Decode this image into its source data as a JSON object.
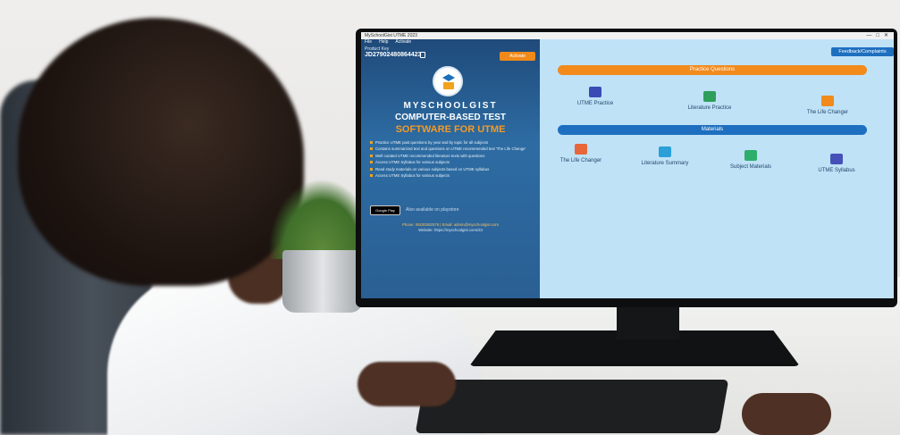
{
  "app": {
    "window_title": "MySchoolGist UTME 2023",
    "menu": [
      "File",
      "Help",
      "Activate"
    ],
    "window_controls": [
      "—",
      "□",
      "✕"
    ]
  },
  "left_panel": {
    "product_key_label": "Product Key",
    "product_key": "JD27902480864423",
    "activate_label": "Activate",
    "brand_line1": "MYSCHOOLGIST",
    "brand_line2": "COMPUTER-BASED TEST",
    "brand_line3": "SOFTWARE FOR UTME",
    "features": [
      "Practice UTME past questions by year and by topic for all subjects",
      "Contains summarized text and questions on UTME recommended text 'The Life Change'",
      "Well curated UTME recommended literature texts with questions",
      "Access UTME Syllabus for various subjects",
      "Read study materials on various subjects based on UTME syllabus",
      "Access UTME Syllabus for various subjects"
    ],
    "gplay_label": "Google Play",
    "also_available": "Also available on playstore",
    "contact_line1": "Phone: 09100282576  |  Email: admin@myschoolgist.com",
    "contact_line2": "Website: https://myschoolgist.com/cbt"
  },
  "right_panel": {
    "feedback_label": "Feedback/Complaints",
    "practice_header": "Practice Questions",
    "practice_items": [
      {
        "label": "UTME Practice",
        "icon": "laptop-icon",
        "color": "#3b4bb5"
      },
      {
        "label": "Literature Practice",
        "icon": "monitor-icon",
        "color": "#2e9e5b"
      },
      {
        "label": "The Life Changer",
        "icon": "book-icon",
        "color": "#f08a1a"
      }
    ],
    "materials_header": "Materials",
    "materials_items": [
      {
        "label": "The Life Changer",
        "icon": "book-icon",
        "color": "#e7663a"
      },
      {
        "label": "Literature Summary",
        "icon": "open-book-icon",
        "color": "#2a9fd8"
      },
      {
        "label": "Subject Materials",
        "icon": "folder-icon",
        "color": "#2eae6a"
      },
      {
        "label": "UTME Syllabus",
        "icon": "syllabus-icon",
        "color": "#4651b8"
      }
    ]
  }
}
